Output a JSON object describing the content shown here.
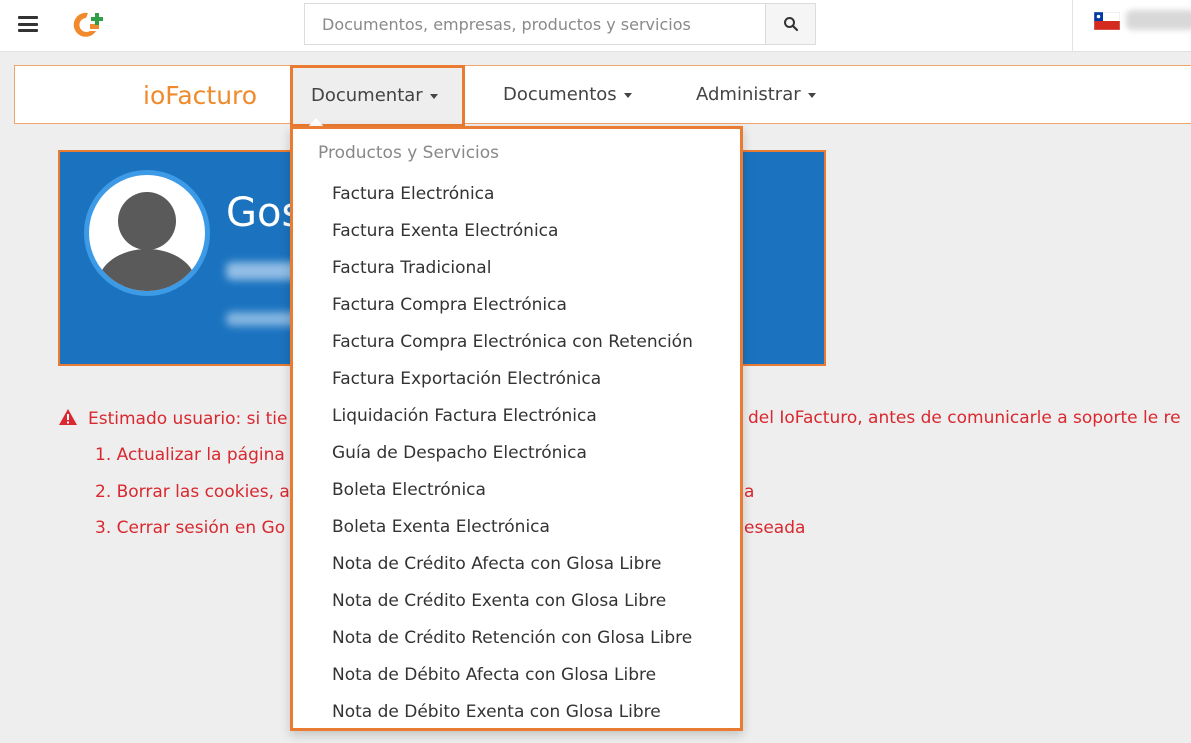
{
  "search": {
    "placeholder": "Documentos, empresas, productos y servicios"
  },
  "nav": {
    "brand": "ioFacturo",
    "items": [
      {
        "label": "Documentar"
      },
      {
        "label": "Documentos"
      },
      {
        "label": "Administrar"
      }
    ]
  },
  "profile": {
    "name_partial": "Gos"
  },
  "warning": {
    "text_left": "Estimado usuario: si tie",
    "text_right": "del IoFacturo, antes de comunicarle a soporte le re",
    "steps": [
      {
        "left": "1. Actualizar la página",
        "right": ""
      },
      {
        "left": "2. Borrar las cookies, a",
        "right": "a"
      },
      {
        "left": "3. Cerrar sesión en Go",
        "right": "eseada"
      }
    ]
  },
  "dropdown": {
    "header": "Productos y Servicios",
    "items": [
      "Factura Electrónica",
      "Factura Exenta Electrónica",
      "Factura Tradicional",
      "Factura Compra Electrónica",
      "Factura Compra Electrónica con Retención",
      "Factura Exportación Electrónica",
      "Liquidación Factura Electrónica",
      "Guía de Despacho Electrónica",
      "Boleta Electrónica",
      "Boleta Exenta Electrónica",
      "Nota de Crédito Afecta con Glosa Libre",
      "Nota de Crédito Exenta con Glosa Libre",
      "Nota de Crédito Retención con Glosa Libre",
      "Nota de Débito Afecta con Glosa Libre",
      "Nota de Débito Exenta con Glosa Libre"
    ]
  },
  "colors": {
    "accent": "#ea7b33",
    "brand": "#f08a2c",
    "profile_bg": "#1b73bf",
    "warning": "#d9282f"
  },
  "icons": {
    "menu": "hamburger-icon",
    "logo": "app-logo-icon",
    "search": "search-icon",
    "flag": "chile-flag-icon",
    "warning": "warning-triangle-icon"
  }
}
